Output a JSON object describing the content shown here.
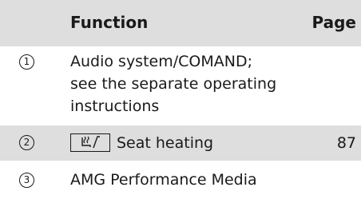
{
  "table": {
    "headers": {
      "function": "Function",
      "page": "Page"
    },
    "rows": [
      {
        "number": "1",
        "lines": [
          "Audio system/COMAND;",
          "see the separate operating",
          "instructions"
        ],
        "page": ""
      },
      {
        "number": "2",
        "icon": "seat-heating-icon",
        "function": "Seat heating",
        "page": "87"
      },
      {
        "number": "3",
        "function": "AMG Performance Media",
        "page": ""
      }
    ]
  },
  "colors": {
    "shaded_row": "#dedede",
    "text": "#1a1a1a"
  }
}
